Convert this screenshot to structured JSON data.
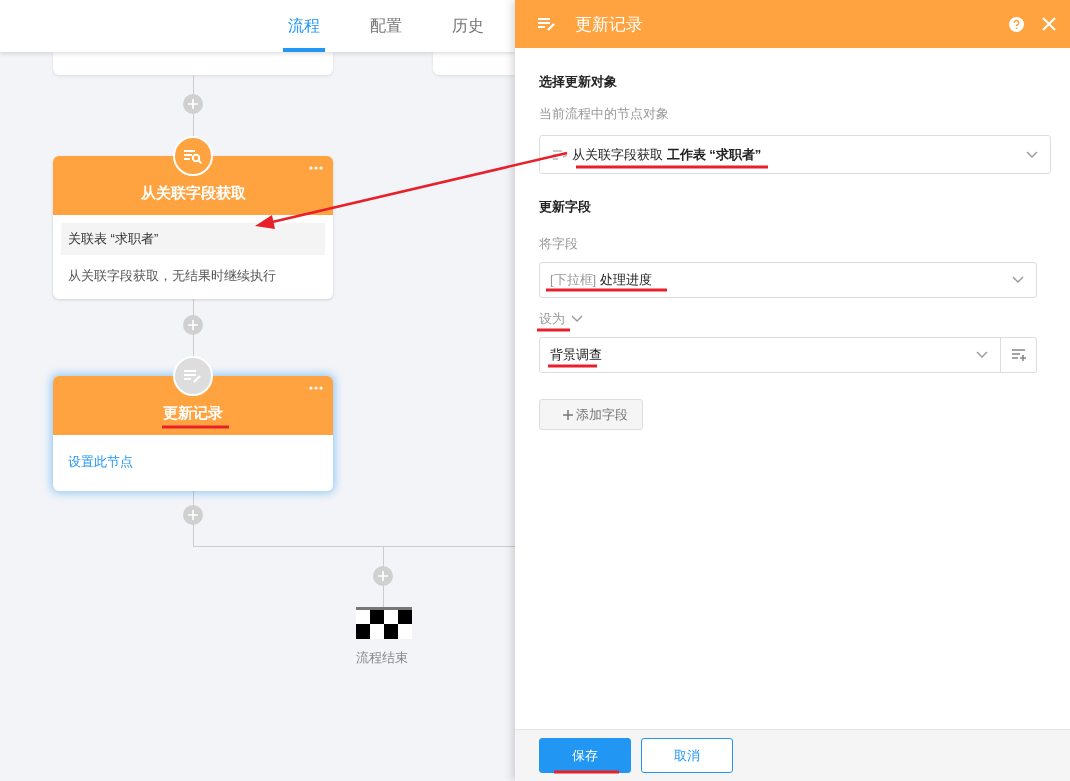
{
  "tabs": [
    {
      "label": "流程",
      "selected": true
    },
    {
      "label": "配置",
      "selected": false
    },
    {
      "label": "历史",
      "selected": false
    }
  ],
  "flow": {
    "nodes": [
      {
        "kind": "fetch",
        "title": "从关联字段获取",
        "selected": false,
        "tag": "关联表 “求职者”",
        "summary": "从关联字段获取，无结果时继续执行"
      },
      {
        "kind": "update",
        "title": "更新记录",
        "selected": true,
        "link": "设置此节点"
      }
    ],
    "end_label": "流程结束"
  },
  "panel": {
    "title": "更新记录",
    "target": {
      "heading": "选择更新对象",
      "label": "当前流程中的节点对象",
      "value": "从关联字段获取 **工作表 “求职者”**"
    },
    "fields": {
      "heading": "更新字段",
      "field_label": "将字段",
      "field_type": "[下拉框]",
      "field_value": "处理进度",
      "set_label": "设为",
      "set_value": "背景调查",
      "add_button": "添加字段"
    },
    "buttons": [
      {
        "label": "保存",
        "kind": "primary"
      },
      {
        "label": "取消",
        "kind": "secondary"
      }
    ]
  }
}
